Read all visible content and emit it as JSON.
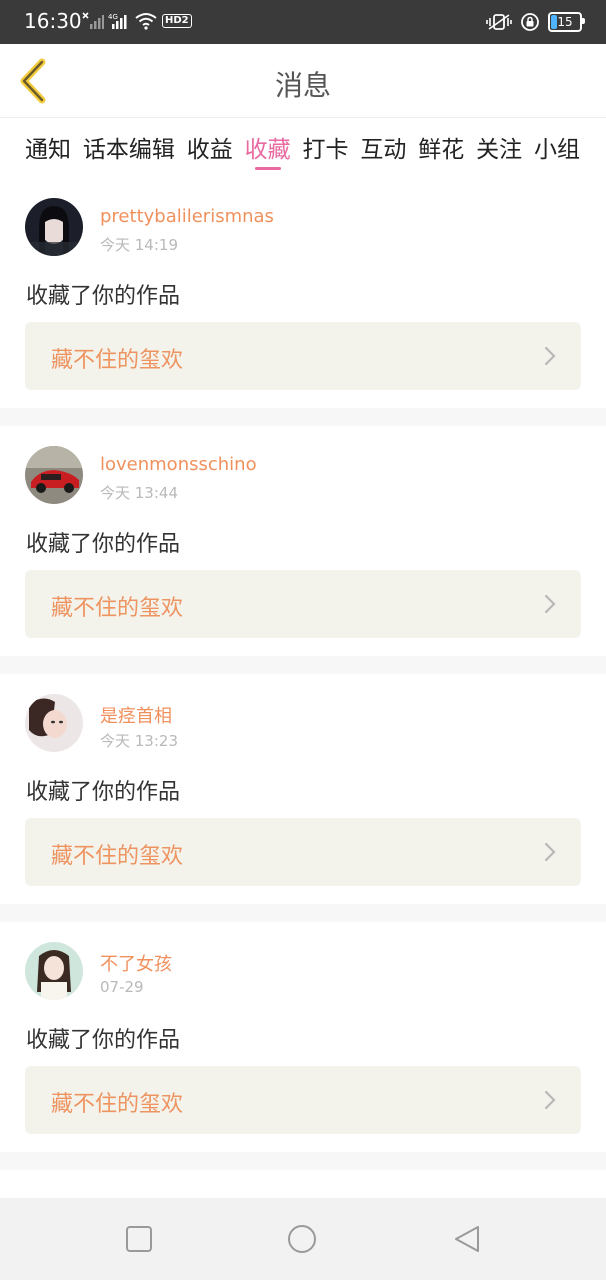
{
  "status_bar": {
    "time": "16:30",
    "hd_label": "HD2",
    "network_label": "4G",
    "battery": "15",
    "icons": [
      "signal-x-icon",
      "signal-4g-icon",
      "wifi-icon",
      "hd-icon",
      "vibrate-icon",
      "lock-rotation-icon",
      "battery-icon"
    ]
  },
  "header": {
    "title": "消息",
    "back_icon": "chevron-left-icon"
  },
  "tabs": [
    {
      "label": "通知",
      "active": false
    },
    {
      "label": "话本编辑",
      "active": false
    },
    {
      "label": "收益",
      "active": false
    },
    {
      "label": "收藏",
      "active": true
    },
    {
      "label": "打卡",
      "active": false
    },
    {
      "label": "互动",
      "active": false
    },
    {
      "label": "鲜花",
      "active": false
    },
    {
      "label": "关注",
      "active": false
    },
    {
      "label": "小组",
      "active": false
    }
  ],
  "items": [
    {
      "username": "prettybalilerismnas",
      "time": "今天 14:19",
      "message": "收藏了你的作品",
      "work": "藏不住的玺欢"
    },
    {
      "username": "lovenmonsschino",
      "time": "今天 13:44",
      "message": "收藏了你的作品",
      "work": "藏不住的玺欢"
    },
    {
      "username": "是痉首相",
      "time": "今天 13:23",
      "message": "收藏了你的作品",
      "work": "藏不住的玺欢"
    },
    {
      "username": "不了女孩",
      "time": "07-29",
      "message": "收藏了你的作品",
      "work": "藏不住的玺欢"
    }
  ],
  "colors": {
    "accent_pink": "#e86aa0",
    "username_orange": "#f0915d",
    "work_title_orange": "#ee9460",
    "back_arrow_yellow": "#f2cc3b"
  },
  "nav_bar": [
    "square-icon",
    "circle-home-icon",
    "triangle-back-icon"
  ]
}
